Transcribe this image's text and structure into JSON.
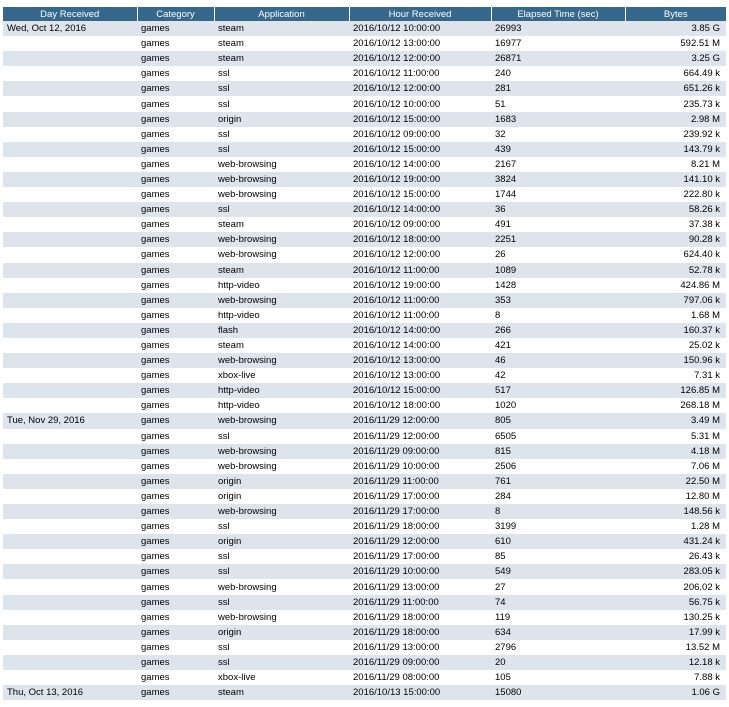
{
  "headers": [
    "Day Received",
    "Category",
    "Application",
    "Hour Received",
    "Elapsed Time (sec)",
    "Bytes"
  ],
  "rows": [
    [
      "Wed, Oct 12, 2016",
      "games",
      "steam",
      "2016/10/12 10:00:00",
      "26993",
      "3.85 G"
    ],
    [
      "",
      "games",
      "steam",
      "2016/10/12 13:00:00",
      "16977",
      "592.51 M"
    ],
    [
      "",
      "games",
      "steam",
      "2016/10/12 12:00:00",
      "26871",
      "3.25 G"
    ],
    [
      "",
      "games",
      "ssl",
      "2016/10/12 11:00:00",
      "240",
      "664.49 k"
    ],
    [
      "",
      "games",
      "ssl",
      "2016/10/12 12:00:00",
      "281",
      "651.26 k"
    ],
    [
      "",
      "games",
      "ssl",
      "2016/10/12 10:00:00",
      "51",
      "235.73 k"
    ],
    [
      "",
      "games",
      "origin",
      "2016/10/12 15:00:00",
      "1683",
      "2.98 M"
    ],
    [
      "",
      "games",
      "ssl",
      "2016/10/12 09:00:00",
      "32",
      "239.92 k"
    ],
    [
      "",
      "games",
      "ssl",
      "2016/10/12 15:00:00",
      "439",
      "143.79 k"
    ],
    [
      "",
      "games",
      "web-browsing",
      "2016/10/12 14:00:00",
      "2167",
      "8.21 M"
    ],
    [
      "",
      "games",
      "web-browsing",
      "2016/10/12 19:00:00",
      "3824",
      "141.10 k"
    ],
    [
      "",
      "games",
      "web-browsing",
      "2016/10/12 15:00:00",
      "1744",
      "222.80 k"
    ],
    [
      "",
      "games",
      "ssl",
      "2016/10/12 14:00:00",
      "36",
      "58.26 k"
    ],
    [
      "",
      "games",
      "steam",
      "2016/10/12 09:00:00",
      "491",
      "37.38 k"
    ],
    [
      "",
      "games",
      "web-browsing",
      "2016/10/12 18:00:00",
      "2251",
      "90.28 k"
    ],
    [
      "",
      "games",
      "web-browsing",
      "2016/10/12 12:00:00",
      "26",
      "624.40 k"
    ],
    [
      "",
      "games",
      "steam",
      "2016/10/12 11:00:00",
      "1089",
      "52.78 k"
    ],
    [
      "",
      "games",
      "http-video",
      "2016/10/12 19:00:00",
      "1428",
      "424.86 M"
    ],
    [
      "",
      "games",
      "web-browsing",
      "2016/10/12 11:00:00",
      "353",
      "797.06 k"
    ],
    [
      "",
      "games",
      "http-video",
      "2016/10/12 11:00:00",
      "8",
      "1.68 M"
    ],
    [
      "",
      "games",
      "flash",
      "2016/10/12 14:00:00",
      "266",
      "160.37 k"
    ],
    [
      "",
      "games",
      "steam",
      "2016/10/12 14:00:00",
      "421",
      "25.02 k"
    ],
    [
      "",
      "games",
      "web-browsing",
      "2016/10/12 13:00:00",
      "46",
      "150.96 k"
    ],
    [
      "",
      "games",
      "xbox-live",
      "2016/10/12 13:00:00",
      "42",
      "7.31 k"
    ],
    [
      "",
      "games",
      "http-video",
      "2016/10/12 15:00:00",
      "517",
      "126.85 M"
    ],
    [
      "",
      "games",
      "http-video",
      "2016/10/12 18:00:00",
      "1020",
      "268.18 M"
    ],
    [
      "Tue, Nov 29, 2016",
      "games",
      "web-browsing",
      "2016/11/29 12:00:00",
      "805",
      "3.49 M"
    ],
    [
      "",
      "games",
      "ssl",
      "2016/11/29 12:00:00",
      "6505",
      "5.31 M"
    ],
    [
      "",
      "games",
      "web-browsing",
      "2016/11/29 09:00:00",
      "815",
      "4.18 M"
    ],
    [
      "",
      "games",
      "web-browsing",
      "2016/11/29 10:00:00",
      "2506",
      "7.06 M"
    ],
    [
      "",
      "games",
      "origin",
      "2016/11/29 11:00:00",
      "761",
      "22.50 M"
    ],
    [
      "",
      "games",
      "origin",
      "2016/11/29 17:00:00",
      "284",
      "12.80 M"
    ],
    [
      "",
      "games",
      "web-browsing",
      "2016/11/29 17:00:00",
      "8",
      "148.56 k"
    ],
    [
      "",
      "games",
      "ssl",
      "2016/11/29 18:00:00",
      "3199",
      "1.28 M"
    ],
    [
      "",
      "games",
      "origin",
      "2016/11/29 12:00:00",
      "610",
      "431.24 k"
    ],
    [
      "",
      "games",
      "ssl",
      "2016/11/29 17:00:00",
      "85",
      "26.43 k"
    ],
    [
      "",
      "games",
      "ssl",
      "2016/11/29 10:00:00",
      "549",
      "283.05 k"
    ],
    [
      "",
      "games",
      "web-browsing",
      "2016/11/29 13:00:00",
      "27",
      "206.02 k"
    ],
    [
      "",
      "games",
      "ssl",
      "2016/11/29 11:00:00",
      "74",
      "56.75 k"
    ],
    [
      "",
      "games",
      "web-browsing",
      "2016/11/29 18:00:00",
      "119",
      "130.25 k"
    ],
    [
      "",
      "games",
      "origin",
      "2016/11/29 18:00:00",
      "634",
      "17.99 k"
    ],
    [
      "",
      "games",
      "ssl",
      "2016/11/29 13:00:00",
      "2796",
      "13.52 M"
    ],
    [
      "",
      "games",
      "ssl",
      "2016/11/29 09:00:00",
      "20",
      "12.18 k"
    ],
    [
      "",
      "games",
      "xbox-live",
      "2016/11/29 08:00:00",
      "105",
      "7.88 k"
    ],
    [
      "Thu, Oct 13, 2016",
      "games",
      "steam",
      "2016/10/13 15:00:00",
      "15080",
      "1.06 G"
    ]
  ]
}
